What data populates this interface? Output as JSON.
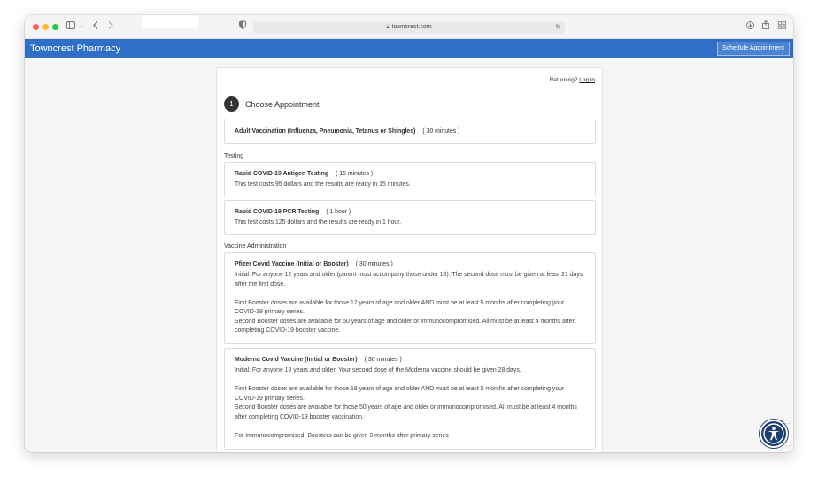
{
  "browser": {
    "url": "towncrest.com"
  },
  "header": {
    "brand": "Towncrest Pharmacy",
    "schedule_button": "Schedule Appointment"
  },
  "panel": {
    "returning_text": "Returning?",
    "login_link": "Log in",
    "step_number": "1",
    "step_title": "Choose Appointment"
  },
  "services": {
    "general": [
      {
        "name": "Adult Vaccination (Influenza, Pneumonia, Tetanus or Shingles)",
        "duration": "( 30 minutes )"
      }
    ],
    "testing_label": "Testing",
    "testing": [
      {
        "name": "Rapid COVID-19 Antigen Testing",
        "duration": "( 15 minutes )",
        "description": "This test costs 95 dollars and the results are ready in 15 minutes."
      },
      {
        "name": "Rapid COVID-19 PCR Testing",
        "duration": "( 1 hour )",
        "description": "This test costs 125 dollars and the results are ready in 1 hour."
      }
    ],
    "vaccine_label": "Vaccine Administration",
    "vaccines": [
      {
        "name": "Pfizer Covid Vaccine (Initial or Booster)",
        "duration": "( 30 minutes )",
        "initial": "Initial: For anyone 12 years and older (parent must accompany those under 18). The second dose must be given at least 21 days after the first dose.",
        "first_booster": "First Booster doses are available for those 12 years of age and older AND must be at least 5 months after completing your COVID-19 primary series.",
        "second_booster": "Second Booster doses are available for 50 years of age and older or immunocompromised. All must be at least 4 months after completing COVID-19 booster vaccine."
      },
      {
        "name": "Moderna Covid Vaccine (Initial or Booster)",
        "duration": "( 30 minutes )",
        "initial": "Initial: For anyone 18 years and older. Your second dose of the Moderna vaccine should be given 28 days.",
        "first_booster": "First Booster doses are available for those 18 years of age and older AND must be at least 5 months after completing your COVID-19 primary series.",
        "second_booster": "Second Booster doses are available for those 50 years of age and older or immunocompromised. All must be at least 4 months after completing COVID-19 booster vaccination.",
        "immunocompromised": "For Immunocompromised: Boosters can be given 3 months after primary series"
      }
    ]
  },
  "icons": {
    "sidebar": "sidebar-icon",
    "back": "chevron-left-icon",
    "forward": "chevron-right-icon",
    "shield": "shield-icon",
    "lock": "lock-icon",
    "reload": "reload-icon",
    "download": "download-icon",
    "share": "share-icon",
    "tabs": "tab-overview-icon",
    "accessibility": "accessibility-icon"
  },
  "colors": {
    "header_blue": "#2f6fc7",
    "accessibility_navy": "#1b3e73"
  }
}
